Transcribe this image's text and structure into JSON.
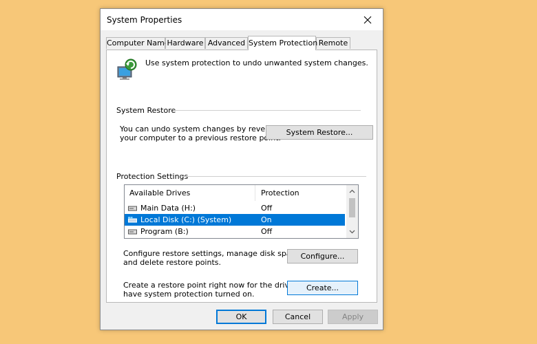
{
  "window": {
    "title": "System Properties"
  },
  "tabs": [
    {
      "label": "Computer Name",
      "active": false
    },
    {
      "label": "Hardware",
      "active": false
    },
    {
      "label": "Advanced",
      "active": false
    },
    {
      "label": "System Protection",
      "active": true
    },
    {
      "label": "Remote",
      "active": false
    }
  ],
  "intro": {
    "text": "Use system protection to undo unwanted system changes.",
    "icon": "system-protection-icon"
  },
  "system_restore": {
    "group_label": "System Restore",
    "description_line1": "You can undo system changes by reverting",
    "description_line2": "your computer to a previous restore point.",
    "button_label": "System Restore..."
  },
  "protection_settings": {
    "group_label": "Protection Settings",
    "columns": [
      "Available Drives",
      "Protection"
    ],
    "drives": [
      {
        "name": "Main Data (H:)",
        "protection": "Off",
        "selected": false
      },
      {
        "name": "Local Disk (C:) (System)",
        "protection": "On",
        "selected": true
      },
      {
        "name": "Program (B:)",
        "protection": "Off",
        "selected": false
      }
    ],
    "configure_line1": "Configure restore settings, manage disk space,",
    "configure_line2": "and delete restore points.",
    "configure_label": "Configure...",
    "create_line1": "Create a restore point right now for the drives that",
    "create_line2": "have system protection turned on.",
    "create_label": "Create..."
  },
  "footer": {
    "ok_label": "OK",
    "cancel_label": "Cancel",
    "apply_label": "Apply"
  },
  "colors": {
    "background": "#f7c778",
    "selection": "#0078d7",
    "accent": "#0078d7"
  }
}
